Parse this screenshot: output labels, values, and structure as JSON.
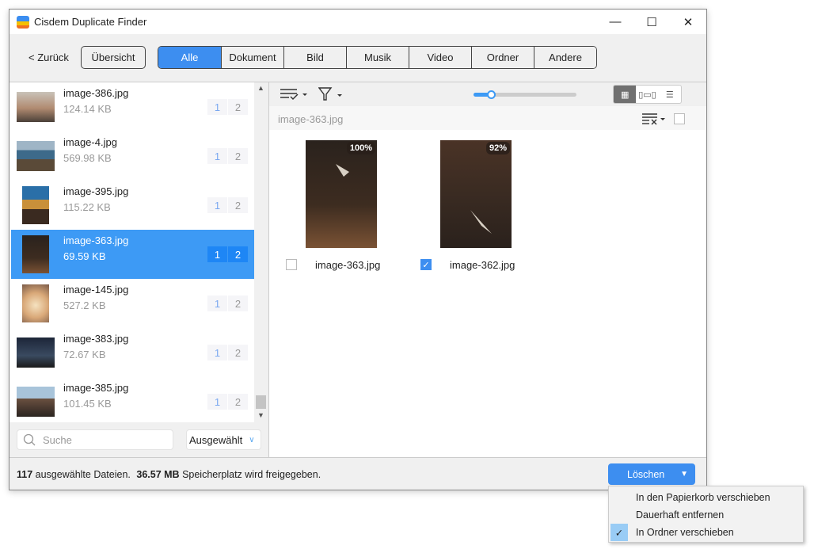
{
  "window": {
    "title": "Cisdem Duplicate Finder",
    "minimize": "—",
    "maximize": "☐",
    "close": "✕"
  },
  "toolbar": {
    "back": "< Zurück",
    "overview": "Übersicht",
    "tabs": [
      "Alle",
      "Dokument",
      "Bild",
      "Musik",
      "Video",
      "Ordner",
      "Andere"
    ],
    "active_tab": "Alle"
  },
  "list": [
    {
      "name": "image-386.jpg",
      "size": "124.14 KB",
      "b1": "1",
      "b2": "2"
    },
    {
      "name": "image-4.jpg",
      "size": "569.98 KB",
      "b1": "1",
      "b2": "2"
    },
    {
      "name": "image-395.jpg",
      "size": "115.22 KB",
      "b1": "1",
      "b2": "2"
    },
    {
      "name": "image-363.jpg",
      "size": "69.59 KB",
      "b1": "1",
      "b2": "2",
      "selected": true
    },
    {
      "name": "image-145.jpg",
      "size": "527.2 KB",
      "b1": "1",
      "b2": "2"
    },
    {
      "name": "image-383.jpg",
      "size": "72.67 KB",
      "b1": "1",
      "b2": "2"
    },
    {
      "name": "image-385.jpg",
      "size": "101.45 KB",
      "b1": "1",
      "b2": "2"
    }
  ],
  "search": {
    "placeholder": "Suche"
  },
  "filter_select": "Ausgewählt",
  "detail": {
    "group_title": "image-363.jpg",
    "zoom_fraction": 0.17,
    "files": [
      {
        "name": "image-363.jpg",
        "similarity": "100%",
        "checked": false
      },
      {
        "name": "image-362.jpg",
        "similarity": "92%",
        "checked": true
      }
    ]
  },
  "footer": {
    "count": "117",
    "count_text": "ausgewählte Dateien.",
    "size": "36.57 MB",
    "size_text": "Speicherplatz wird freigegeben.",
    "delete": "Löschen"
  },
  "menu": {
    "items": [
      "In den Papierkorb verschieben",
      "Dauerhaft entfernen",
      "In Ordner verschieben"
    ],
    "checked": "In Ordner verschieben"
  },
  "colors": {
    "accent": "#3d8ef0",
    "selection": "#3d9af5"
  }
}
